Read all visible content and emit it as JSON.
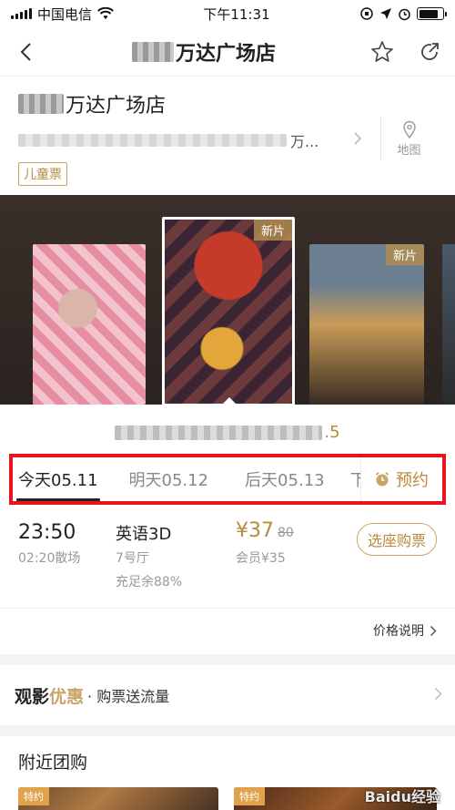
{
  "status_bar": {
    "carrier": "中国电信",
    "time": "下午11:31"
  },
  "nav": {
    "title": "万达广场店"
  },
  "cinema": {
    "name": "万达广场店",
    "address_suffix": "万...",
    "map_label": "地图",
    "tag": "儿童票"
  },
  "posters": [
    {
      "badge": ""
    },
    {
      "badge": "新片"
    },
    {
      "badge": "新片"
    }
  ],
  "movie": {
    "rating_suffix": ".5"
  },
  "date_tabs": [
    {
      "label": "今天05.11",
      "active": true
    },
    {
      "label": "明天05.12",
      "active": false
    },
    {
      "label": "后天05.13",
      "active": false
    },
    {
      "label": "下",
      "active": false
    }
  ],
  "reserve_label": "预约",
  "showtime": {
    "start": "23:50",
    "end": "02:20散场",
    "language": "英语3D",
    "hall": "7号厅",
    "seats": "充足余88%",
    "price": "¥37",
    "original_price": "80",
    "member_price": "会员¥35",
    "buy_label": "选座购票"
  },
  "price_note": "价格说明",
  "promo": {
    "title": "观影",
    "accent": "优惠",
    "subtitle": "· 购票送流量"
  },
  "nearby": {
    "title": "附近团购",
    "thumb_badge": "特约"
  },
  "watermark": "Baidu经验",
  "colors": {
    "accent": "#b88a3e",
    "highlight_box": "#e8141b"
  }
}
